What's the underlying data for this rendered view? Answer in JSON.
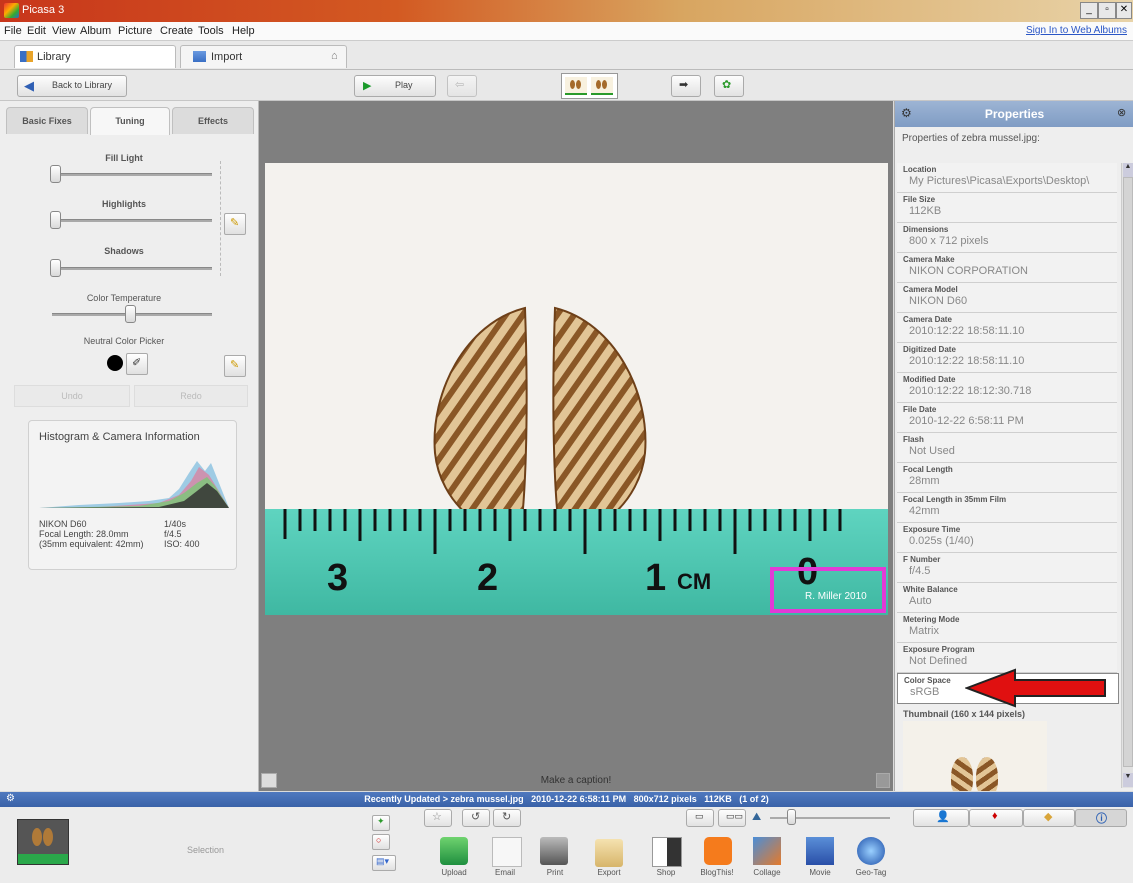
{
  "window": {
    "title": "Picasa 3"
  },
  "menu": [
    "File",
    "Edit",
    "View",
    "Album",
    "Picture",
    "Create",
    "Tools",
    "Help"
  ],
  "signin": "Sign In to Web Albums",
  "tabs": {
    "library": "Library",
    "import": "Import"
  },
  "toolbar": {
    "back": "Back to Library",
    "play": "Play"
  },
  "left": {
    "tabs": [
      "Basic Fixes",
      "Tuning",
      "Effects"
    ],
    "sliders": {
      "fill_light": "Fill Light",
      "highlights": "Highlights",
      "shadows": "Shadows",
      "color_temp": "Color Temperature"
    },
    "neutral_picker": "Neutral Color Picker",
    "undo": "Undo",
    "redo": "Redo",
    "histogram": {
      "title": "Histogram & Camera Information",
      "camera": "NIKON D60",
      "focal": "Focal Length: 28.0mm",
      "equiv": "(35mm equivalent: 42mm)",
      "shutter": "1/40s",
      "aperture": "f/4.5",
      "iso": "ISO: 400"
    }
  },
  "photo": {
    "ruler_numbers": [
      "3",
      "2",
      "1",
      "0"
    ],
    "ruler_unit": "CM",
    "watermark": "R. Miller 2010",
    "caption_placeholder": "Make a caption!"
  },
  "properties": {
    "title": "Properties",
    "subtitle": "Properties of zebra mussel.jpg:",
    "rows": [
      {
        "k": "Location",
        "v": "My Pictures\\Picasa\\Exports\\Desktop\\"
      },
      {
        "k": "File Size",
        "v": "112KB"
      },
      {
        "k": "Dimensions",
        "v": "800 x 712 pixels"
      },
      {
        "k": "Camera Make",
        "v": "NIKON CORPORATION"
      },
      {
        "k": "Camera Model",
        "v": "NIKON D60"
      },
      {
        "k": "Camera Date",
        "v": "2010:12:22 18:58:11.10"
      },
      {
        "k": "Digitized Date",
        "v": "2010:12:22 18:58:11.10"
      },
      {
        "k": "Modified Date",
        "v": "2010:12:22 18:12:30.718"
      },
      {
        "k": "File Date",
        "v": "2010-12-22 6:58:11 PM"
      },
      {
        "k": "Flash",
        "v": "Not Used"
      },
      {
        "k": "Focal Length",
        "v": "28mm"
      },
      {
        "k": "Focal Length in 35mm Film",
        "v": "42mm"
      },
      {
        "k": "Exposure Time",
        "v": "0.025s (1/40)"
      },
      {
        "k": "F Number",
        "v": "f/4.5"
      },
      {
        "k": "White Balance",
        "v": "Auto"
      },
      {
        "k": "Metering Mode",
        "v": "Matrix"
      },
      {
        "k": "Exposure Program",
        "v": "Not Defined"
      },
      {
        "k": "Color Space",
        "v": "sRGB"
      }
    ],
    "thumbnail": "Thumbnail (160 x 144 pixels)"
  },
  "status": "Recently Updated > zebra mussel.jpg   2010-12-22 6:58:11 PM   800x712 pixels   112KB   (1 of 2)",
  "bottom": {
    "selection": "Selection",
    "actions": [
      "Upload",
      "Email",
      "Print",
      "Export",
      "Shop",
      "BlogThis!",
      "Collage",
      "Movie",
      "Geo-Tag"
    ]
  },
  "colors": {
    "accent_blue": "#3a62a8",
    "highlight_box": "#e23ad6",
    "arrow": "#e01010",
    "ruler": "#4fc9b2"
  }
}
